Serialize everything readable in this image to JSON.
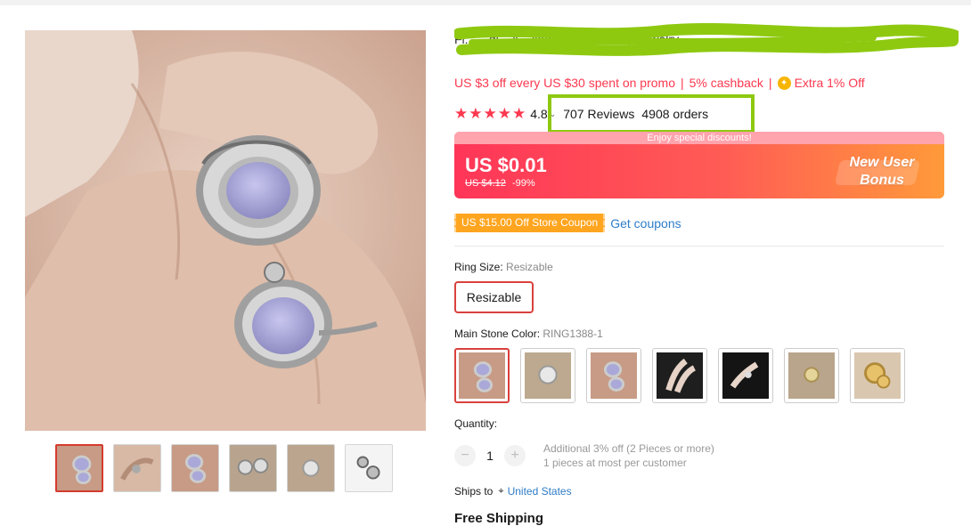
{
  "product": {
    "title": "Fl... ...dj ...lj ...llagt ...Gl... Trendy Jewelry"
  },
  "promo": {
    "offer": "US $3 off every US $30 spent on promo",
    "cashback": "5% cashback",
    "extra": "Extra 1% Off",
    "coin_icon": "coin-icon"
  },
  "rating": {
    "stars": "★★★★★",
    "score": "4.8",
    "reviews": "707 Reviews",
    "orders": "4908 orders"
  },
  "price": {
    "strip": "Enjoy special discounts!",
    "current": "US $0.01",
    "original": "US $4.12",
    "discount": "-99%",
    "badge_line1": "New User",
    "badge_line2": "Bonus"
  },
  "coupon": {
    "tag": "US $15.00 Off Store Coupon",
    "link": "Get coupons"
  },
  "ring_size": {
    "label": "Ring Size:",
    "value": "Resizable",
    "option": "Resizable"
  },
  "stone_color": {
    "label": "Main Stone Color:",
    "value": "RING1388-1",
    "option_count": 7
  },
  "quantity": {
    "label": "Quantity:",
    "minus": "−",
    "value": "1",
    "plus": "+",
    "note1": "Additional 3% off (2 Pieces or more)",
    "note2": "1 pieces at most per customer"
  },
  "shipping": {
    "label": "Ships to",
    "country": "United States",
    "free": "Free Shipping"
  },
  "colors": {
    "accent_red": "#fd384f",
    "highlight_green": "#8ec910",
    "link_blue": "#2e7cc8",
    "coupon_orange": "#ffa51f"
  }
}
